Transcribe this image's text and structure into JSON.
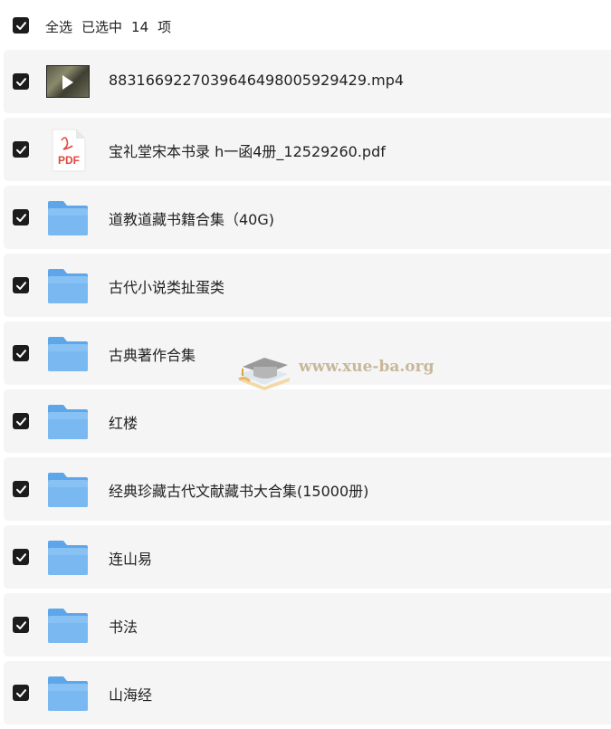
{
  "header": {
    "select_all_label": "全选",
    "selected_prefix": "已选中",
    "selected_count": "14",
    "selected_suffix": "项"
  },
  "items": [
    {
      "type": "video",
      "name": "883166922703964649800592942­9.mp4",
      "checked": true
    },
    {
      "type": "pdf",
      "name": "宝礼堂宋本书录 h一函4册_12529260.pdf",
      "checked": true
    },
    {
      "type": "folder",
      "name": "道教道藏书籍合集（40G)",
      "checked": true
    },
    {
      "type": "folder",
      "name": "古代小说类扯蛋类",
      "checked": true
    },
    {
      "type": "folder",
      "name": "古典著作合集",
      "checked": true
    },
    {
      "type": "folder",
      "name": "红楼",
      "checked": true
    },
    {
      "type": "folder",
      "name": "经典珍藏古代文献藏书大合集(15000册)",
      "checked": true
    },
    {
      "type": "folder",
      "name": "连山易",
      "checked": true
    },
    {
      "type": "folder",
      "name": "书法",
      "checked": true
    },
    {
      "type": "folder",
      "name": "山海经",
      "checked": true
    }
  ],
  "pdf_icon_label": "PDF",
  "watermark": {
    "text": "www.xue-ba.org"
  },
  "colors": {
    "checkbox": "#1c1c1c",
    "row_bg": "#f5f5f5",
    "folder": "#79b8f0",
    "pdf_red": "#e0473e"
  }
}
